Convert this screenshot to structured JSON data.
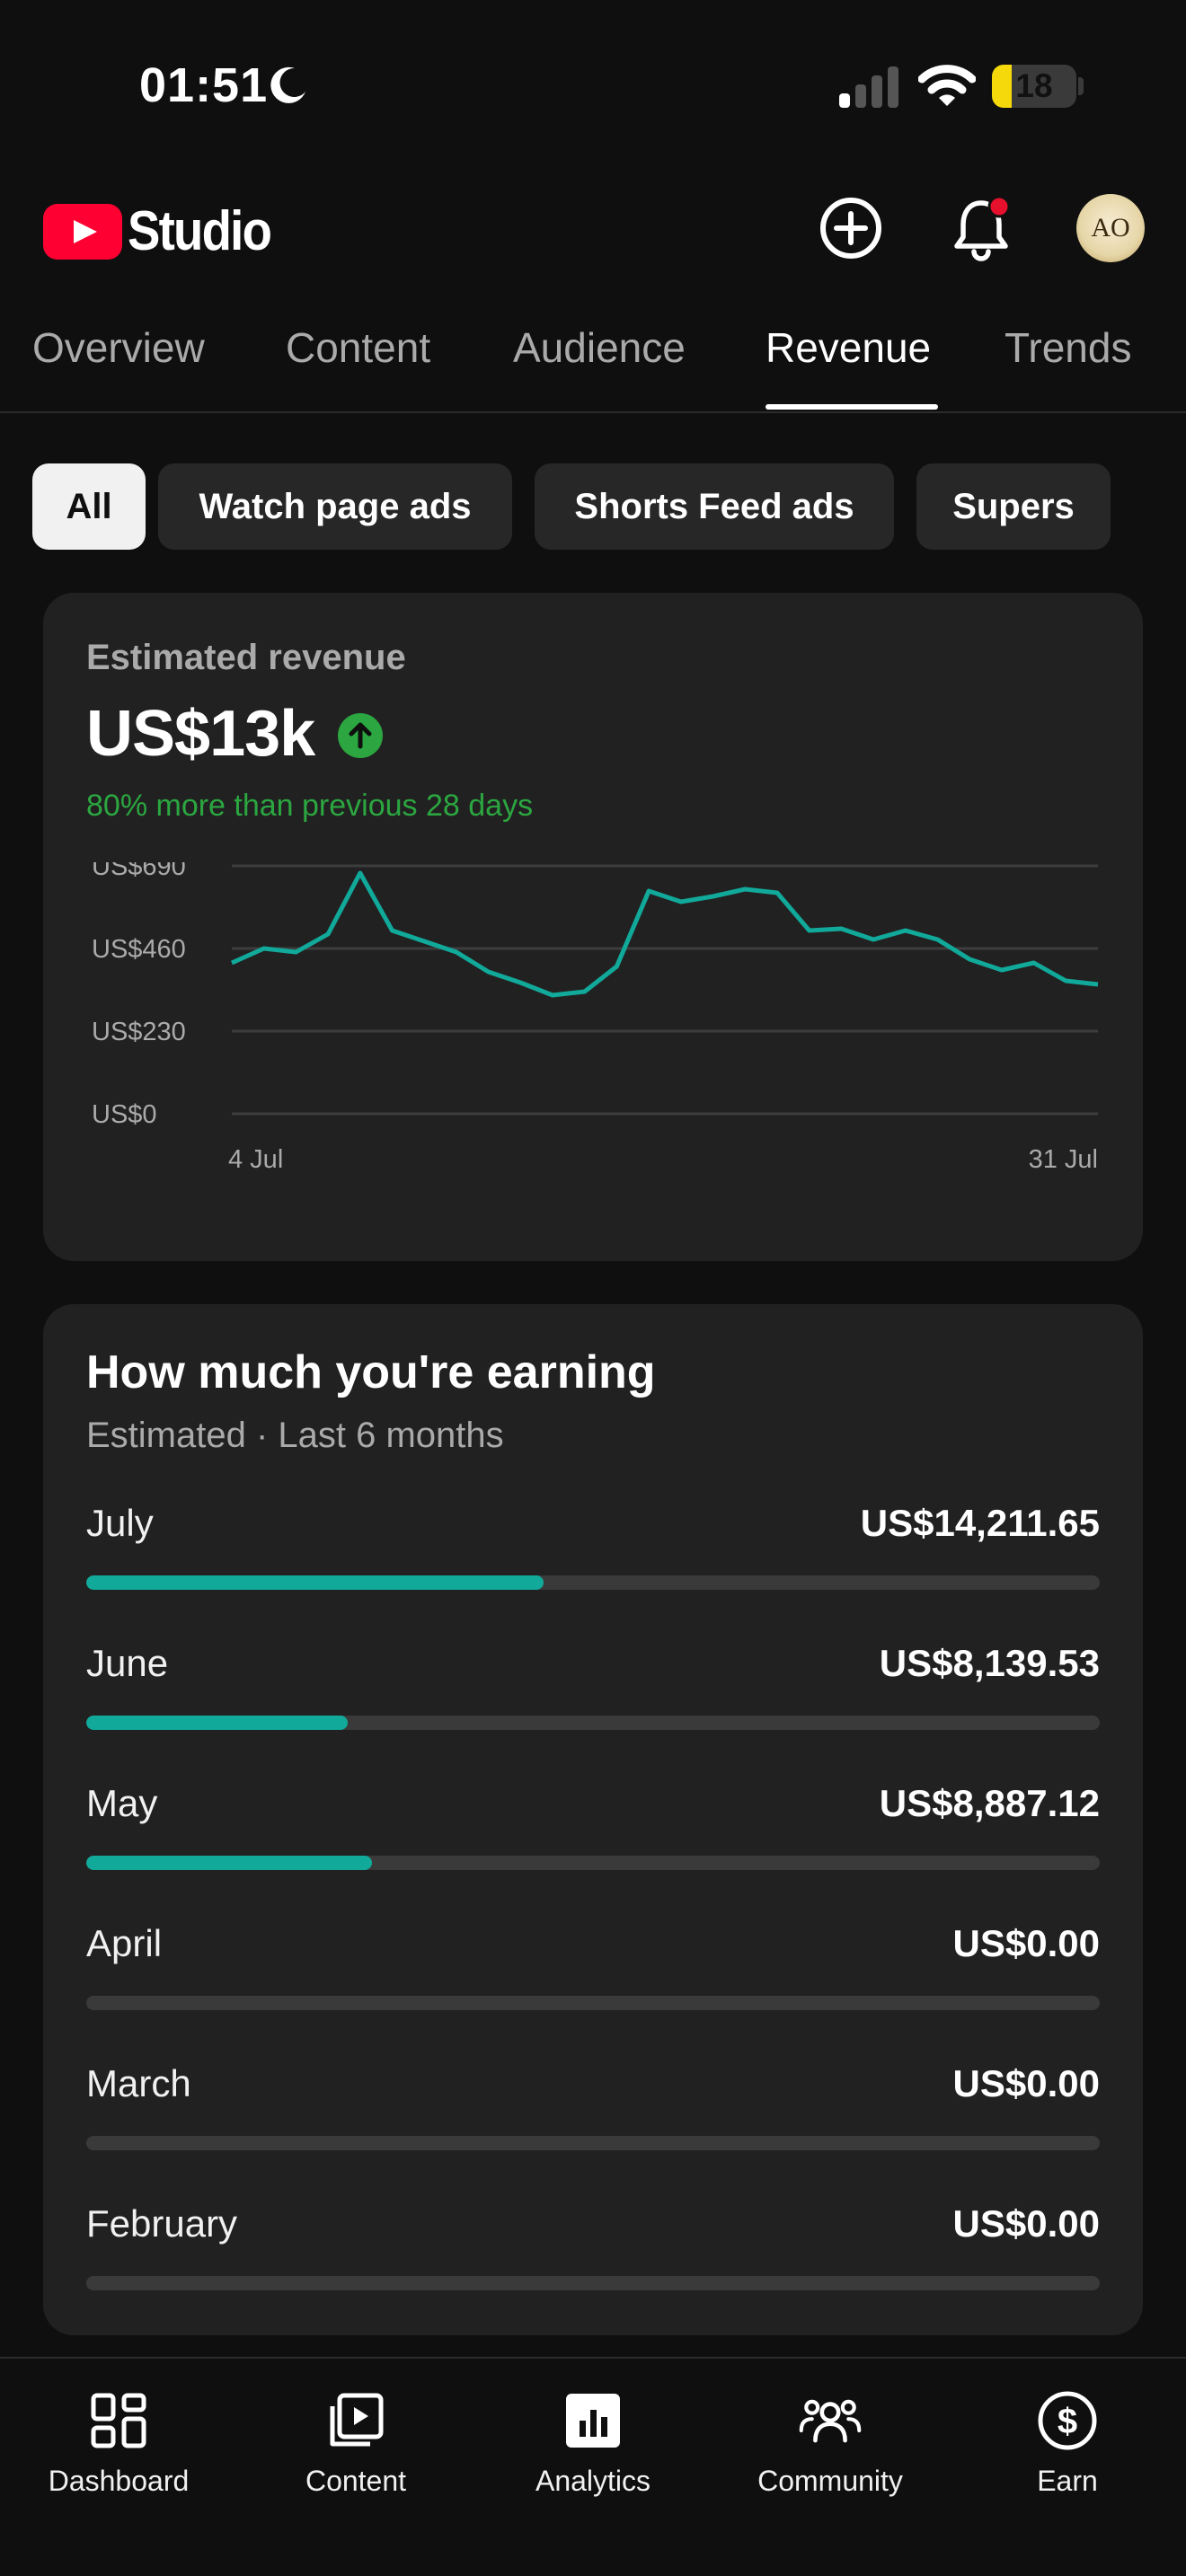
{
  "status_bar": {
    "time": "01:51",
    "battery": "18"
  },
  "header": {
    "logo_text": "Studio",
    "avatar_text": "AO"
  },
  "tabs": [
    {
      "label": "Overview"
    },
    {
      "label": "Content"
    },
    {
      "label": "Audience"
    },
    {
      "label": "Revenue",
      "active": true
    },
    {
      "label": "Trends"
    }
  ],
  "chips": [
    {
      "label": "All",
      "active": true
    },
    {
      "label": "Watch page ads"
    },
    {
      "label": "Shorts Feed ads"
    },
    {
      "label": "Supers"
    }
  ],
  "revenue_card": {
    "label": "Estimated revenue",
    "value": "US$13k",
    "delta": "80% more than previous 28 days"
  },
  "chart_data": {
    "type": "line",
    "x_labels": [
      "4 Jul",
      "31 Jul"
    ],
    "y_ticks": [
      "US$690",
      "US$460",
      "US$230",
      "US$0"
    ],
    "y_tick_values": [
      690,
      460,
      230,
      0
    ],
    "ylim": [
      0,
      690
    ],
    "grid": true,
    "series": [
      {
        "values": [
          420,
          460,
          450,
          500,
          670,
          510,
          480,
          450,
          395,
          365,
          330,
          340,
          410,
          620,
          590,
          605,
          625,
          615,
          510,
          515,
          485,
          510,
          485,
          430,
          400,
          420,
          370,
          360
        ]
      }
    ],
    "color": "#11a99a"
  },
  "earning_card": {
    "title": "How much you're earning",
    "subtitle": "Estimated · Last 6 months",
    "months": [
      {
        "name": "July",
        "amount": "US$14,211.65",
        "value": 14211.65
      },
      {
        "name": "June",
        "amount": "US$8,139.53",
        "value": 8139.53
      },
      {
        "name": "May",
        "amount": "US$8,887.12",
        "value": 8887.12
      },
      {
        "name": "April",
        "amount": "US$0.00",
        "value": 0
      },
      {
        "name": "March",
        "amount": "US$0.00",
        "value": 0
      },
      {
        "name": "February",
        "amount": "US$0.00",
        "value": 0
      }
    ],
    "scale_max": 31500
  },
  "bottom_nav": [
    {
      "label": "Dashboard",
      "icon": "dashboard-icon"
    },
    {
      "label": "Content",
      "icon": "content-icon"
    },
    {
      "label": "Analytics",
      "icon": "analytics-icon",
      "active": true
    },
    {
      "label": "Community",
      "icon": "community-icon"
    },
    {
      "label": "Earn",
      "icon": "earn-icon"
    }
  ]
}
